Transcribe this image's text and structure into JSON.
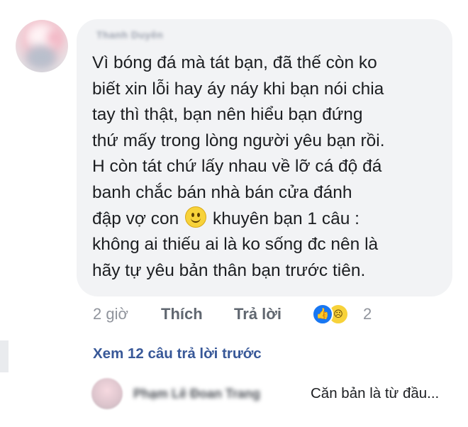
{
  "comment": {
    "author": "Thanh Duyên",
    "lines": [
      "Vì bóng đá mà tát bạn, đã thế còn ko",
      "biết xin lỗi hay áy náy khi bạn nói chia",
      "tay thì thật, bạn nên hiểu bạn đứng",
      "thứ mấy trong lòng người yêu bạn rồi.",
      "H còn tát chứ lấy nhau về lỡ cá độ đá",
      "banh chắc bán nhà bán cửa đánh",
      "khuyên bạn 1 câu :",
      "không ai thiếu ai là ko sống đc nên là",
      "hãy tự yêu bản thân bạn trước tiên."
    ],
    "line7_prefix": "đập vợ con",
    "emoji_icon": "smiley-icon"
  },
  "actions": {
    "time": "2 giờ",
    "like": "Thích",
    "reply": "Trả lời",
    "reaction_count": "2",
    "reaction_icons": [
      "like-icon",
      "sad-icon"
    ]
  },
  "view_more": "Xem 12 câu trả lời trước",
  "reply": {
    "author": "Phạm Lê Đoan Trang",
    "text": "Căn bản là từ đầu..."
  }
}
